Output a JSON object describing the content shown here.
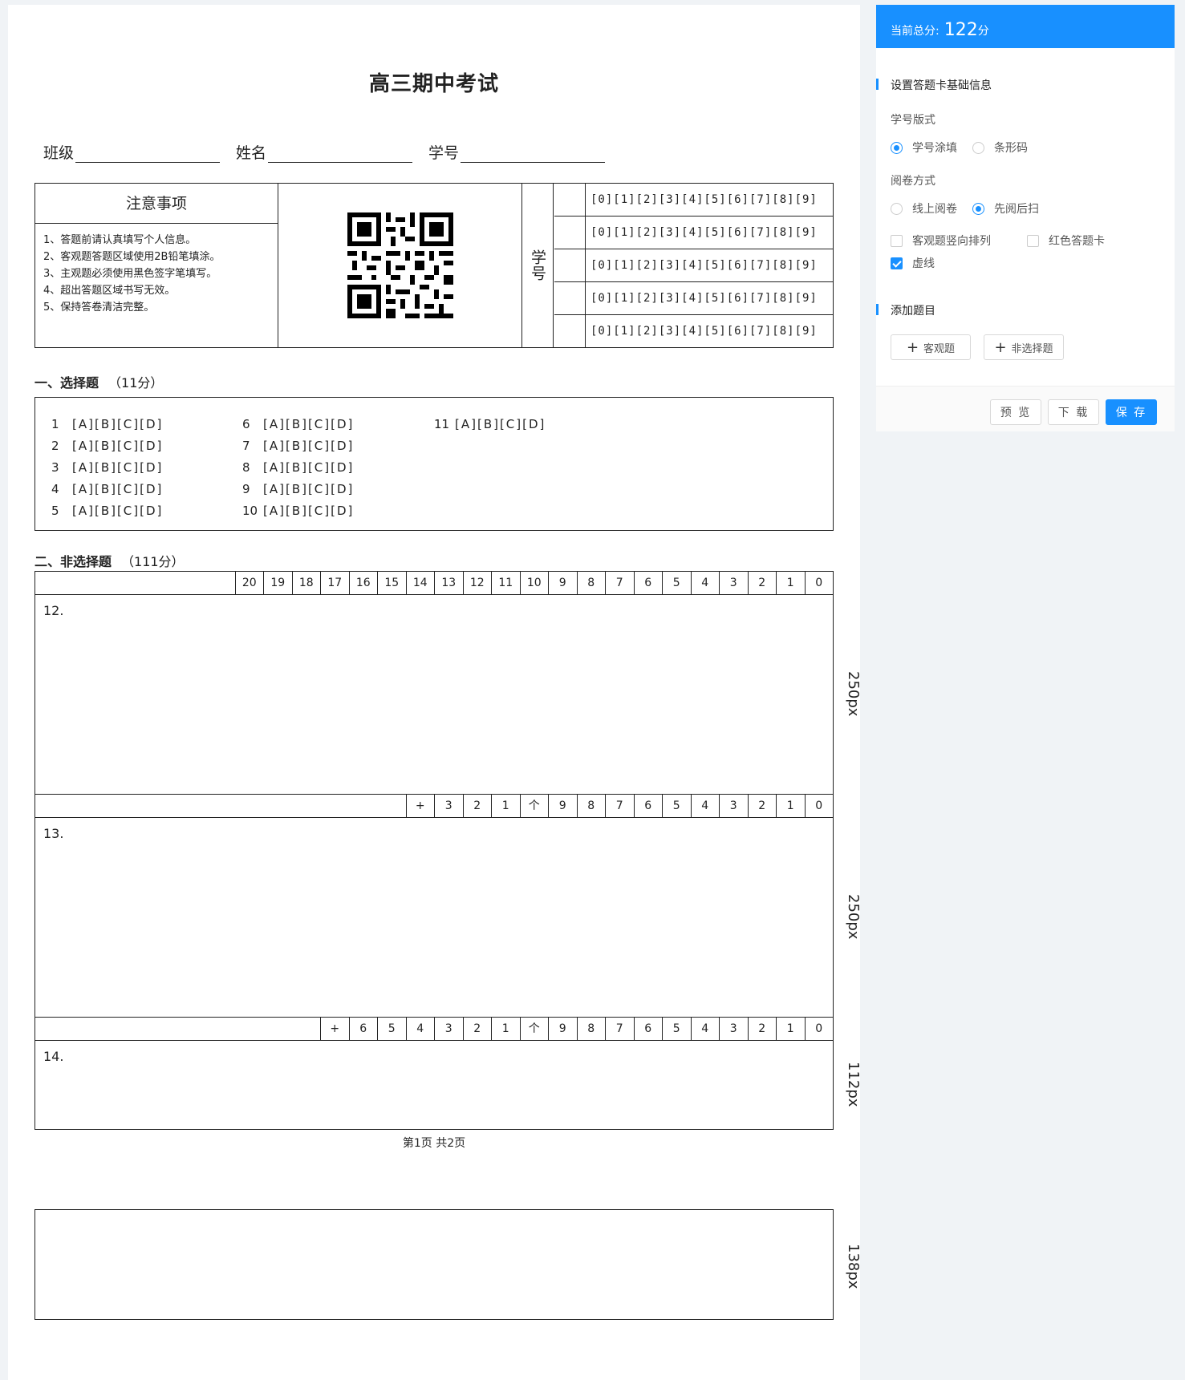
{
  "exam": {
    "title": "高三期中考试",
    "fields": {
      "class": "班级",
      "name": "姓名",
      "student_no": "学号"
    },
    "notes_title": "注意事项",
    "notes": [
      "1、答题前请认真填写个人信息。",
      "2、客观题答题区域使用2B铅笔填涂。",
      "3、主观题必须使用黑色签字笔填写。",
      "4、超出答题区域书写无效。",
      "5、保持答卷清洁完整。"
    ],
    "student_id_label": "学号",
    "digit_options": "[0][1][2][3][4][5][6][7][8][9]",
    "section1": {
      "title": "一、选择题",
      "score": "（11分）"
    },
    "mc_options": "[A][B][C][D]",
    "mc_columns": [
      [
        "1",
        "2",
        "3",
        "4",
        "5"
      ],
      [
        "6",
        "7",
        "8",
        "9",
        "10"
      ],
      [
        "11"
      ]
    ],
    "section2": {
      "title": "二、非选择题",
      "score": "（111分）"
    },
    "score_rows": [
      [
        "20",
        "19",
        "18",
        "17",
        "16",
        "15",
        "14",
        "13",
        "12",
        "11",
        "10",
        "9",
        "8",
        "7",
        "6",
        "5",
        "4",
        "3",
        "2",
        "1",
        "0"
      ],
      [
        "+",
        "3",
        "2",
        "1",
        "个",
        "9",
        "8",
        "7",
        "6",
        "5",
        "4",
        "3",
        "2",
        "1",
        "0"
      ],
      [
        "+",
        "6",
        "5",
        "4",
        "3",
        "2",
        "1",
        "个",
        "9",
        "8",
        "7",
        "6",
        "5",
        "4",
        "3",
        "2",
        "1",
        "0"
      ]
    ],
    "questions": [
      {
        "num": "12.",
        "height_label": "250px"
      },
      {
        "num": "13.",
        "height_label": "250px"
      },
      {
        "num": "14.",
        "height_label": "112px"
      }
    ],
    "extra_box_label": "138px",
    "page_footer": "第1页 共2页"
  },
  "panel": {
    "total_label": "当前总分:",
    "total_value": "122",
    "total_unit": "分",
    "section_basic": "设置答题卡基础信息",
    "id_format_label": "学号版式",
    "id_format_options": [
      "学号涂填",
      "条形码"
    ],
    "id_format_selected": "学号涂填",
    "marking_label": "阅卷方式",
    "marking_options": [
      "线上阅卷",
      "先阅后扫"
    ],
    "marking_selected": "先阅后扫",
    "checkboxes": [
      {
        "label": "客观题竖向排列",
        "checked": false
      },
      {
        "label": "红色答题卡",
        "checked": false
      },
      {
        "label": "虚线",
        "checked": true
      }
    ],
    "section_add": "添加题目",
    "add_objective": "客观题",
    "add_subjective": "非选择题",
    "btn_preview": "预 览",
    "btn_download": "下 载",
    "btn_save": "保 存",
    "accent_color": "#1890ff"
  }
}
